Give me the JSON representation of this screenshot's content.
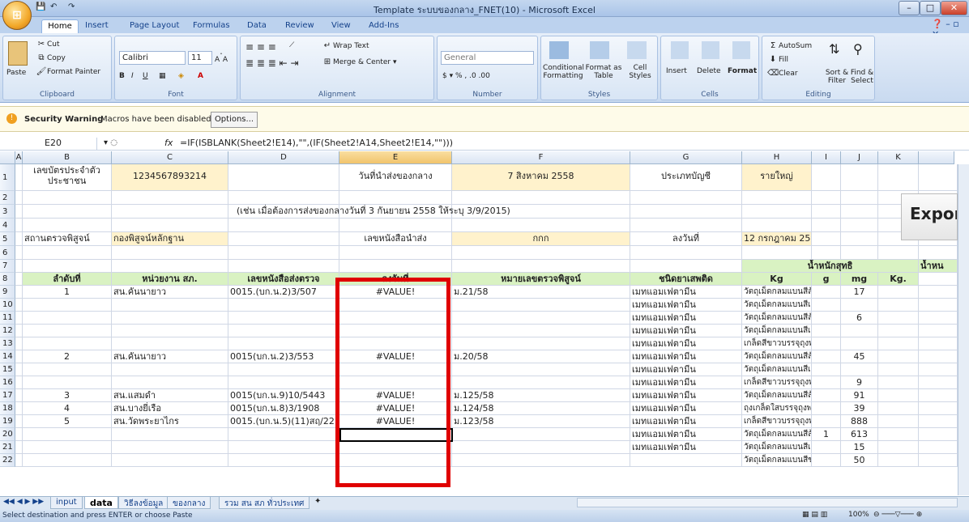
{
  "window": {
    "title": "Template ระบบของกลาง_FNET(10) - Microsoft Excel"
  },
  "tabs": [
    "Home",
    "Insert",
    "Page Layout",
    "Formulas",
    "Data",
    "Review",
    "View",
    "Add-Ins"
  ],
  "ribbon": {
    "clipboard": {
      "paste": "Paste",
      "cut": "Cut",
      "copy": "Copy",
      "format_painter": "Format Painter",
      "label": "Clipboard"
    },
    "font": {
      "name": "Calibri",
      "size": "11",
      "label": "Font"
    },
    "alignment": {
      "wrap": "Wrap Text",
      "merge": "Merge & Center",
      "label": "Alignment"
    },
    "number": {
      "format": "General",
      "label": "Number"
    },
    "styles": {
      "conditional": "Conditional Formatting",
      "format_table": "Format as Table",
      "cell_styles": "Cell Styles",
      "label": "Styles"
    },
    "cells": {
      "insert": "Insert",
      "delete": "Delete",
      "format": "Format",
      "label": "Cells"
    },
    "editing": {
      "autosum": "AutoSum",
      "fill": "Fill",
      "clear": "Clear",
      "sort": "Sort & Filter",
      "find": "Find & Select",
      "label": "Editing"
    }
  },
  "security": {
    "title": "Security Warning",
    "message": "Macros have been disabled.",
    "options": "Options..."
  },
  "formula_bar": {
    "name_box": "E20",
    "fx": "fx",
    "formula": "=IF(ISBLANK(Sheet2!E14),\"\",(IF(Sheet2!A14,Sheet2!E14,\"\")))"
  },
  "columns": [
    "A",
    "B",
    "C",
    "D",
    "E",
    "F",
    "G",
    "H",
    "I",
    "J",
    "K"
  ],
  "rows": [
    "1",
    "2",
    "3",
    "4",
    "5",
    "6",
    "7",
    "8",
    "9",
    "10",
    "11",
    "12",
    "13",
    "14",
    "15",
    "16",
    "17",
    "18",
    "19",
    "20",
    "21",
    "22"
  ],
  "cells": {
    "r1": {
      "b": "เลขบัตรประจำตัวประชาชน",
      "c": "1234567893214",
      "e": "วันที่นำส่งของกลาง",
      "f": "7 สิงหาคม  2558",
      "g": "ประเภทบัญชี",
      "h": "รายใหญ่"
    },
    "r3": {
      "d": "(เช่น  เมื่อต้องการส่งของกลางวันที่  3 กันยายน  2558 ให้ระบุ  3/9/2015)"
    },
    "r5": {
      "b": "สถานตรวจพิสูจน์",
      "c": "กองพิสูจน์หลักฐาน",
      "e": "เลขหนังสือนำส่ง",
      "f": "กกก",
      "g": "ลงวันที่",
      "h": "12 กรกฎาคม  2558"
    },
    "r7": {
      "h": "น้ำหนักสุทธิ",
      "k": "น้ำหน"
    },
    "r8": {
      "b": "ลำดับที่",
      "c": "หน่วยงาน สภ.",
      "d": "เลขหนังสือส่งตรวจ",
      "e": "ลงวันที่",
      "f": "หมายเลขตรวจพิสูจน์",
      "g": "ชนิดยาเสพติด",
      "h": "Kg",
      "i": "g",
      "j": "mg",
      "k": "Kg."
    }
  },
  "data_rows": [
    {
      "row": "9",
      "b": "1",
      "c": "สน.คันนายาว",
      "d": "0015.(บก.น.2)3/507",
      "e": "#VALUE!",
      "f": "ม.21/58",
      "g": "เมทแอมเฟตามีน",
      "h": "วัตถุเม็ดกลมแบนสีส้ม",
      "i": "",
      "j": "17"
    },
    {
      "row": "10",
      "b": "",
      "c": "",
      "d": "",
      "e": "",
      "f": "",
      "g": "เมทแอมเฟตามีน",
      "h": "วัตถุเม็ดกลมแบนสีเขียว",
      "i": "",
      "j": ""
    },
    {
      "row": "11",
      "b": "",
      "c": "",
      "d": "",
      "e": "",
      "f": "",
      "g": "เมทแอมเฟตามีน",
      "h": "วัตถุเม็ดกลมแบนสีส้ม",
      "i": "",
      "j": "6"
    },
    {
      "row": "12",
      "b": "",
      "c": "",
      "d": "",
      "e": "",
      "f": "",
      "g": "เมทแอมเฟตามีน",
      "h": "วัตถุเม็ดกลมแบนสีเขียว",
      "i": "",
      "j": ""
    },
    {
      "row": "13",
      "b": "",
      "c": "",
      "d": "",
      "e": "",
      "f": "",
      "g": "เมทแอมเฟตามีน",
      "h": "เกล็ดสีขาวบรรจุถุงพลาสติก",
      "i": "",
      "j": ""
    },
    {
      "row": "14",
      "b": "2",
      "c": "สน.คันนายาว",
      "d": "0015(บก.น.2)3/553",
      "e": "#VALUE!",
      "f": "ม.20/58",
      "g": "เมทแอมเฟตามีน",
      "h": "วัตถุเม็ดกลมแบนสีส้ม",
      "i": "",
      "j": "45"
    },
    {
      "row": "15",
      "b": "",
      "c": "",
      "d": "",
      "e": "",
      "f": "",
      "g": "เมทแอมเฟตามีน",
      "h": "วัตถุเม็ดกลมแบนสีเขียว",
      "i": "",
      "j": ""
    },
    {
      "row": "16",
      "b": "",
      "c": "",
      "d": "",
      "e": "",
      "f": "",
      "g": "เมทแอมเฟตามีน",
      "h": "เกล็ดสีขาวบรรจุถุงพลาสติก",
      "i": "",
      "j": "9"
    },
    {
      "row": "17",
      "b": "3",
      "c": "สน.แสมดำ",
      "d": "0015(บก.น.9)10/5443",
      "e": "#VALUE!",
      "f": "ม.125/58",
      "g": "เมทแอมเฟตามีน",
      "h": "วัตถุเม็ดกลมแบนสีส้ม",
      "i": "",
      "j": "91"
    },
    {
      "row": "18",
      "b": "4",
      "c": "สน.บางยี่เรือ",
      "d": "0015(บก.น.8)3/1908",
      "e": "#VALUE!",
      "f": "ม.124/58",
      "g": "เมทแอมเฟตามีน",
      "h": "ถุงเกล็ดใสบรรจุถุงพลาสติก",
      "i": "",
      "j": "39"
    },
    {
      "row": "19",
      "b": "5",
      "c": "สน.วัดพระยาไกร",
      "d": "0015.(บก.น.5)(11)สฤ/22",
      "e": "#VALUE!",
      "f": "ม.123/58",
      "g": "เมทแอมเฟตามีน",
      "h": "เกล็ดสีขาวบรรจุถุงพลาสติก",
      "i": "",
      "j": "888"
    },
    {
      "row": "20",
      "b": "",
      "c": "",
      "d": "",
      "e": "",
      "f": "",
      "g": "เมทแอมเฟตามีน",
      "h": "วัตถุเม็ดกลมแบนสีส้ม",
      "i": "1",
      "j": "613"
    },
    {
      "row": "21",
      "b": "",
      "c": "",
      "d": "",
      "e": "",
      "f": "",
      "g": "เมทแอมเฟตามีน",
      "h": "วัตถุเม็ดกลมแบนสีเขียว",
      "i": "",
      "j": "15"
    },
    {
      "row": "22",
      "b": "",
      "c": "",
      "d": "",
      "e": "",
      "f": "",
      "g": "",
      "h": "วัตถุเม็ดกลมแบนสีขาว",
      "i": "",
      "j": "50"
    }
  ],
  "export_button": "Expor",
  "sheet_tabs": [
    "input",
    "data",
    "วิธีลงข้อมูล",
    "ของกลาง",
    "รวม สน สภ ทั่วประเทศ"
  ],
  "active_sheet": "data",
  "status": {
    "message": "Select destination and press ENTER or choose Paste",
    "zoom": "100%"
  },
  "highlight_color": "#e00000"
}
